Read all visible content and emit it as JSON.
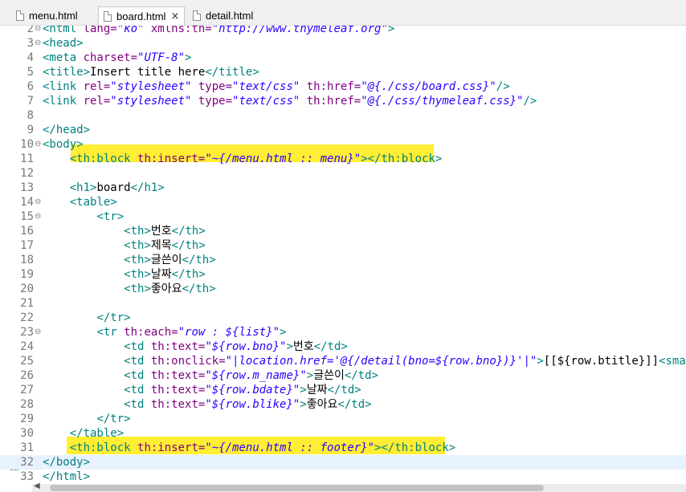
{
  "tabs": [
    {
      "label": "menu.html",
      "active": false
    },
    {
      "label": "board.html",
      "active": true,
      "close": "×"
    },
    {
      "label": "detail.html",
      "active": false
    }
  ],
  "editor": {
    "current_line": 32,
    "lines": [
      {
        "num": "2",
        "fold": "⊖",
        "segs": [
          [
            "tg",
            "<html "
          ],
          [
            "an",
            "lang="
          ],
          [
            "av",
            "\"ko\""
          ],
          [
            "an",
            " xmlns:th="
          ],
          [
            "av",
            "\"http://www.thymeleaf.org\""
          ],
          [
            "tg",
            ">"
          ]
        ]
      },
      {
        "num": "3",
        "fold": "⊖",
        "segs": [
          [
            "tg",
            "<head>"
          ]
        ]
      },
      {
        "num": "4",
        "segs": [
          [
            "tg",
            "<meta "
          ],
          [
            "an",
            "charset="
          ],
          [
            "av",
            "\"UTF-8\""
          ],
          [
            "tg",
            ">"
          ]
        ]
      },
      {
        "num": "5",
        "segs": [
          [
            "tg",
            "<title>"
          ],
          [
            "tx",
            "Insert title here"
          ],
          [
            "tg",
            "</title>"
          ]
        ]
      },
      {
        "num": "6",
        "segs": [
          [
            "tg",
            "<link "
          ],
          [
            "an",
            "rel="
          ],
          [
            "av",
            "\"stylesheet\""
          ],
          [
            "an",
            " type="
          ],
          [
            "av",
            "\"text/css\""
          ],
          [
            "an",
            " th:href="
          ],
          [
            "av",
            "\"@{./css/board.css}\""
          ],
          [
            "tg",
            "/>"
          ]
        ]
      },
      {
        "num": "7",
        "segs": [
          [
            "tg",
            "<link "
          ],
          [
            "an",
            "rel="
          ],
          [
            "av",
            "\"stylesheet\""
          ],
          [
            "an",
            " type="
          ],
          [
            "av",
            "\"text/css\""
          ],
          [
            "an",
            " th:href="
          ],
          [
            "av",
            "\"@{./css/thymeleaf.css}\""
          ],
          [
            "tg",
            "/>"
          ]
        ]
      },
      {
        "num": "8",
        "segs": []
      },
      {
        "num": "9",
        "segs": [
          [
            "tg",
            "</head>"
          ]
        ]
      },
      {
        "num": "10",
        "fold": "⊖",
        "segs": [
          [
            "tg",
            "<body>"
          ]
        ]
      },
      {
        "num": "11",
        "segs": [
          [
            "tx",
            "    "
          ],
          [
            "tg",
            "<th:block "
          ],
          [
            "an",
            "th:insert="
          ],
          [
            "av",
            "\"~{/menu.html :: menu}\""
          ],
          [
            "tg",
            "></th:block>"
          ]
        ]
      },
      {
        "num": "12",
        "segs": []
      },
      {
        "num": "13",
        "segs": [
          [
            "tx",
            "    "
          ],
          [
            "tg",
            "<h1>"
          ],
          [
            "tx",
            "board"
          ],
          [
            "tg",
            "</h1>"
          ]
        ]
      },
      {
        "num": "14",
        "fold": "⊖",
        "segs": [
          [
            "tx",
            "    "
          ],
          [
            "tg",
            "<table>"
          ]
        ]
      },
      {
        "num": "15",
        "fold": "⊖",
        "segs": [
          [
            "tx",
            "        "
          ],
          [
            "tg",
            "<tr>"
          ]
        ]
      },
      {
        "num": "16",
        "segs": [
          [
            "tx",
            "            "
          ],
          [
            "tg",
            "<th>"
          ],
          [
            "tx",
            "번호"
          ],
          [
            "tg",
            "</th>"
          ]
        ]
      },
      {
        "num": "17",
        "segs": [
          [
            "tx",
            "            "
          ],
          [
            "tg",
            "<th>"
          ],
          [
            "tx",
            "제목"
          ],
          [
            "tg",
            "</th>"
          ]
        ]
      },
      {
        "num": "18",
        "segs": [
          [
            "tx",
            "            "
          ],
          [
            "tg",
            "<th>"
          ],
          [
            "tx",
            "글쓴이"
          ],
          [
            "tg",
            "</th>"
          ]
        ]
      },
      {
        "num": "19",
        "segs": [
          [
            "tx",
            "            "
          ],
          [
            "tg",
            "<th>"
          ],
          [
            "tx",
            "날짜"
          ],
          [
            "tg",
            "</th>"
          ]
        ]
      },
      {
        "num": "20",
        "segs": [
          [
            "tx",
            "            "
          ],
          [
            "tg",
            "<th>"
          ],
          [
            "tx",
            "좋아요"
          ],
          [
            "tg",
            "</th>"
          ]
        ]
      },
      {
        "num": "21",
        "segs": []
      },
      {
        "num": "22",
        "segs": [
          [
            "tx",
            "        "
          ],
          [
            "tg",
            "</tr>"
          ]
        ]
      },
      {
        "num": "23",
        "fold": "⊖",
        "segs": [
          [
            "tx",
            "        "
          ],
          [
            "tg",
            "<tr "
          ],
          [
            "an",
            "th:each="
          ],
          [
            "av",
            "\"row : ${list}\""
          ],
          [
            "tg",
            ">"
          ]
        ]
      },
      {
        "num": "24",
        "segs": [
          [
            "tx",
            "            "
          ],
          [
            "tg",
            "<td "
          ],
          [
            "an",
            "th:text="
          ],
          [
            "av",
            "\"${row.bno}\""
          ],
          [
            "tg",
            ">"
          ],
          [
            "tx",
            "번호"
          ],
          [
            "tg",
            "</td>"
          ]
        ]
      },
      {
        "num": "25",
        "segs": [
          [
            "tx",
            "            "
          ],
          [
            "tg",
            "<td "
          ],
          [
            "an",
            "th:onclick="
          ],
          [
            "av",
            "\"|location.href='@{/detail(bno=${row.bno})}'|\""
          ],
          [
            "tg",
            ">"
          ],
          [
            "tx",
            "[[${row.btitle}]]"
          ],
          [
            "tg",
            "<small>"
          ],
          [
            "tx",
            "[["
          ]
        ]
      },
      {
        "num": "26",
        "segs": [
          [
            "tx",
            "            "
          ],
          [
            "tg",
            "<td "
          ],
          [
            "an",
            "th:text="
          ],
          [
            "av",
            "\"${row.m_name}\""
          ],
          [
            "tg",
            ">"
          ],
          [
            "tx",
            "글쓴이"
          ],
          [
            "tg",
            "</td>"
          ]
        ]
      },
      {
        "num": "27",
        "segs": [
          [
            "tx",
            "            "
          ],
          [
            "tg",
            "<td "
          ],
          [
            "an",
            "th:text="
          ],
          [
            "av",
            "\"${row.bdate}\""
          ],
          [
            "tg",
            ">"
          ],
          [
            "tx",
            "날짜"
          ],
          [
            "tg",
            "</td>"
          ]
        ]
      },
      {
        "num": "28",
        "segs": [
          [
            "tx",
            "            "
          ],
          [
            "tg",
            "<td "
          ],
          [
            "an",
            "th:text="
          ],
          [
            "av",
            "\"${row.blike}\""
          ],
          [
            "tg",
            ">"
          ],
          [
            "tx",
            "좋아요"
          ],
          [
            "tg",
            "</td>"
          ]
        ]
      },
      {
        "num": "29",
        "segs": [
          [
            "tx",
            "        "
          ],
          [
            "tg",
            "</tr>"
          ]
        ]
      },
      {
        "num": "30",
        "segs": [
          [
            "tx",
            "    "
          ],
          [
            "tg",
            "</table>"
          ]
        ]
      },
      {
        "num": "31",
        "segs": [
          [
            "tx",
            "    "
          ],
          [
            "tg",
            "<th:block "
          ],
          [
            "an",
            "th:insert="
          ],
          [
            "av",
            "\"~{/menu.html :: footer}\""
          ],
          [
            "tg",
            "></th:block>"
          ]
        ]
      },
      {
        "num": "32",
        "segs": [
          [
            "tg",
            "</body>"
          ]
        ]
      },
      {
        "num": "33",
        "segs": [
          [
            "tg",
            "</html>"
          ]
        ]
      }
    ]
  },
  "colors": {
    "tag": "#008080",
    "attribute": "#7f007f",
    "value": "#2a00ff",
    "highlight": "#ffee33",
    "current_line": "#e8f2fe"
  },
  "icons": {
    "file": "html-file-icon",
    "close": "close-icon",
    "fold": "fold-collapse-icon",
    "scroll_left": "scroll-left-arrow-icon"
  }
}
